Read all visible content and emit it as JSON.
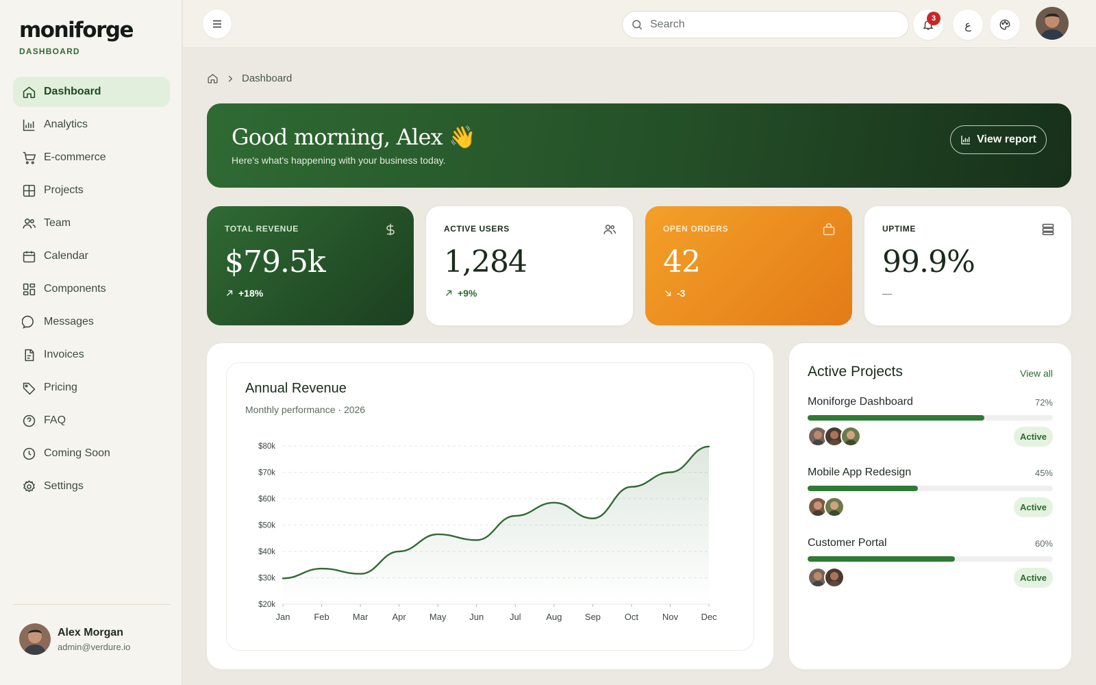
{
  "brand": {
    "name": "moniforge",
    "subtitle": "DASHBOARD"
  },
  "sidebar": {
    "items": [
      {
        "label": "Dashboard",
        "icon": "home-icon",
        "active": true
      },
      {
        "label": "Analytics",
        "icon": "bar-chart-icon"
      },
      {
        "label": "E-commerce",
        "icon": "cart-icon"
      },
      {
        "label": "Projects",
        "icon": "grid-icon"
      },
      {
        "label": "Team",
        "icon": "users-icon"
      },
      {
        "label": "Calendar",
        "icon": "calendar-icon"
      },
      {
        "label": "Components",
        "icon": "components-icon"
      },
      {
        "label": "Messages",
        "icon": "messages-icon"
      },
      {
        "label": "Invoices",
        "icon": "invoice-icon"
      },
      {
        "label": "Pricing",
        "icon": "tag-icon"
      },
      {
        "label": "FAQ",
        "icon": "help-icon"
      },
      {
        "label": "Coming Soon",
        "icon": "clock-icon"
      },
      {
        "label": "Settings",
        "icon": "gear-icon"
      }
    ],
    "user": {
      "name": "Alex Morgan",
      "email": "admin@verdure.io"
    }
  },
  "topbar": {
    "search_placeholder": "Search",
    "notification_count": "3",
    "language_glyph": "ع"
  },
  "breadcrumb": {
    "current": "Dashboard"
  },
  "hero": {
    "greeting": "Good morning, Alex 👋",
    "subtitle": "Here's what's happening with your business today.",
    "button_label": "View report"
  },
  "stats": [
    {
      "label": "TOTAL REVENUE",
      "value": "$79.5k",
      "delta": "+18%",
      "trend": "up",
      "icon": "dollar-icon"
    },
    {
      "label": "ACTIVE USERS",
      "value": "1,284",
      "delta": "+9%",
      "trend": "up",
      "icon": "users-icon"
    },
    {
      "label": "OPEN ORDERS",
      "value": "42",
      "delta": "-3",
      "trend": "down",
      "icon": "bag-icon"
    },
    {
      "label": "UPTIME",
      "value": "99.9%",
      "delta": "—",
      "trend": "flat",
      "icon": "server-icon"
    }
  ],
  "revenue_card": {
    "title": "Annual Revenue",
    "subtitle": "Monthly performance · 2026"
  },
  "chart_data": {
    "type": "area",
    "title": "Annual Revenue",
    "subtitle": "Monthly performance · 2026",
    "categories": [
      "Jan",
      "Feb",
      "Mar",
      "Apr",
      "May",
      "Jun",
      "Jul",
      "Aug",
      "Sep",
      "Oct",
      "Nov",
      "Dec"
    ],
    "values": [
      29.8,
      33.5,
      31.5,
      40,
      46.5,
      44.3,
      53.5,
      58.5,
      52.5,
      64.5,
      70,
      79.8
    ],
    "tick_labels": [
      "$20k",
      "$30k",
      "$40k",
      "$50k",
      "$60k",
      "$70k",
      "$80k"
    ],
    "ylim": [
      20,
      80
    ],
    "grid": true,
    "colors": {
      "line": "#2f6a33",
      "fill": "#2f6a33"
    }
  },
  "projects": {
    "title": "Active Projects",
    "view_all": "View all",
    "items": [
      {
        "name": "Moniforge Dashboard",
        "percent": "72%",
        "progress": 0.72,
        "status": "Active",
        "members": 3
      },
      {
        "name": "Mobile App Redesign",
        "percent": "45%",
        "progress": 0.45,
        "status": "Active",
        "members": 2
      },
      {
        "name": "Customer Portal",
        "percent": "60%",
        "progress": 0.6,
        "status": "Active",
        "members": 2
      }
    ]
  }
}
